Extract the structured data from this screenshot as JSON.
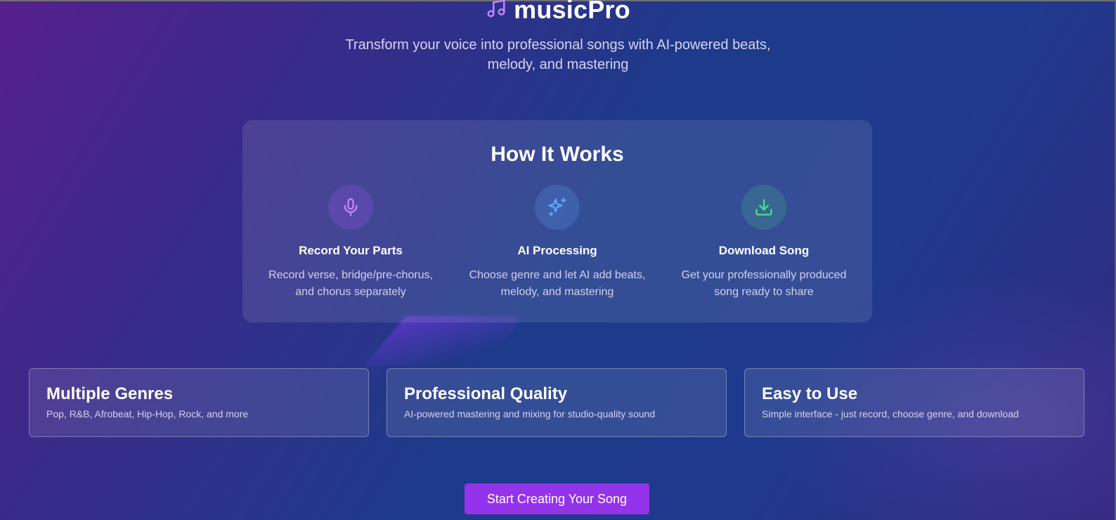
{
  "brand": {
    "title": "musicPro",
    "icon": "music-note-icon"
  },
  "tagline": [
    "Transform your voice into professional songs with AI-powered beats,",
    "melody, and mastering"
  ],
  "how_it_works": {
    "title": "How It Works",
    "steps": [
      {
        "icon": "microphone-icon",
        "title": "Record Your Parts",
        "desc": [
          "Record verse, bridge/pre-chorus,",
          "and chorus separately"
        ]
      },
      {
        "icon": "sparkles-icon",
        "title": "AI Processing",
        "desc": [
          "Choose genre and let AI add beats,",
          "melody, and mastering"
        ]
      },
      {
        "icon": "download-icon",
        "title": "Download Song",
        "desc": [
          "Get your professionally produced",
          "song ready to share"
        ]
      }
    ]
  },
  "features": [
    {
      "title": "Multiple Genres",
      "desc": "Pop, R&B, Afrobeat, Hip-Hop, Rock, and more"
    },
    {
      "title": "Professional Quality",
      "desc": "AI-powered mastering and mixing for studio-quality sound"
    },
    {
      "title": "Easy to Use",
      "desc": "Simple interface - just record, choose genre, and download"
    }
  ],
  "cta_label": "Start Creating Your Song",
  "colors": {
    "accent": "#9333ea",
    "mic": "#c084fc",
    "sparkle": "#60a5fa",
    "download": "#4ade80"
  }
}
